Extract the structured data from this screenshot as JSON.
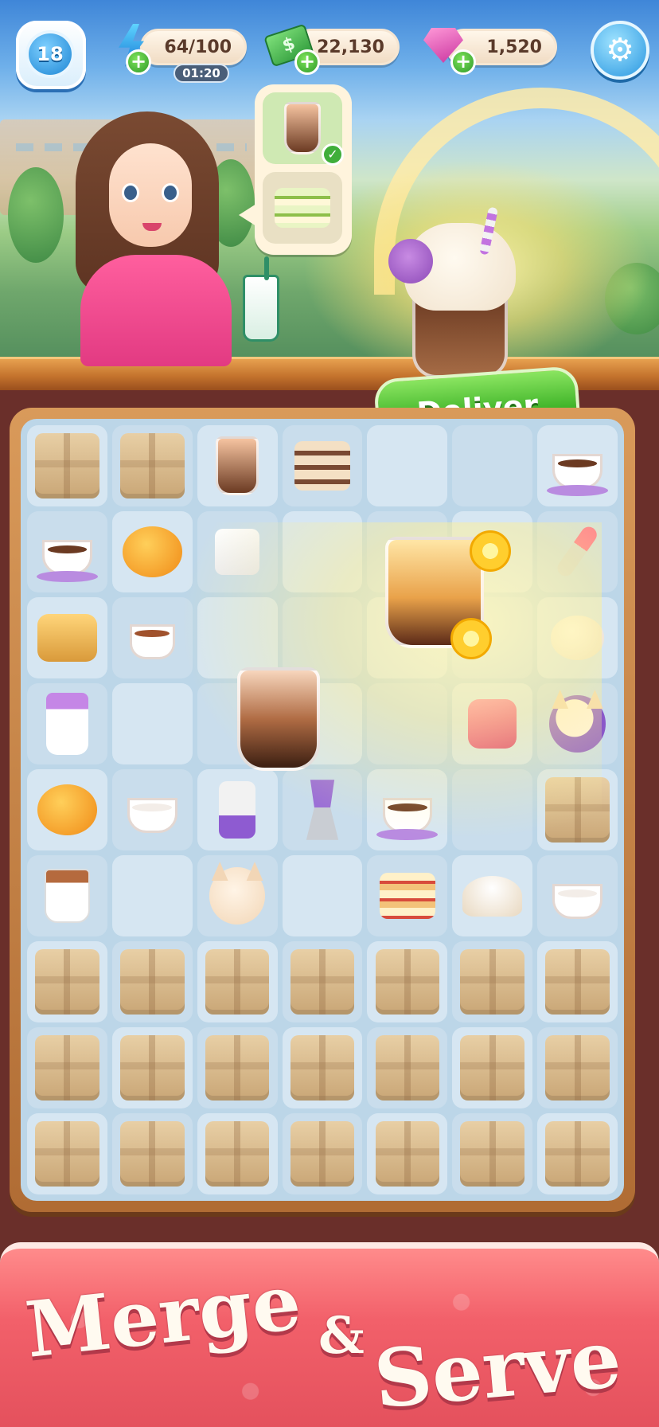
{
  "hud": {
    "level": "18",
    "energy": {
      "value": "64/100",
      "timer": "01:20"
    },
    "cash": {
      "value": "22,130",
      "icon_text": "$"
    },
    "gems": {
      "value": "1,520"
    },
    "plus_symbol": "+",
    "settings_icon": "⚙"
  },
  "order": {
    "items": [
      {
        "name": "whipped-mocha-drink",
        "completed": true,
        "check_symbol": "✓"
      },
      {
        "name": "matcha-layer-cake",
        "completed": false
      }
    ]
  },
  "deliver": {
    "label": "Deliver",
    "item": "whipped-mocha-drink"
  },
  "board": {
    "columns": 7,
    "rows": 9,
    "cells": [
      [
        "box",
        "box",
        "iced-tea",
        "cake-slice",
        "empty",
        "empty",
        "coffee-cup"
      ],
      [
        "latte-cup",
        "melon-bun",
        "sugar-cube",
        "empty",
        "empty",
        "empty",
        "whisk"
      ],
      [
        "toast",
        "spiced-tea",
        "empty",
        "empty",
        "empty",
        "empty",
        "dough"
      ],
      [
        "paper-cup",
        "empty",
        "empty",
        "empty",
        "empty",
        "hand-mixer",
        "cat-purple"
      ],
      [
        "bun",
        "empty-cup",
        "blender",
        "moka-pot",
        "tea-cup",
        "empty",
        "box"
      ],
      [
        "teabag-cup",
        "empty",
        "kitten",
        "empty",
        "layer-cake",
        "flour",
        "empty-cup"
      ],
      [
        "box",
        "box",
        "box",
        "box",
        "box",
        "box",
        "box"
      ],
      [
        "box",
        "box",
        "box",
        "box",
        "box",
        "box",
        "box"
      ],
      [
        "box",
        "box",
        "box",
        "box",
        "box",
        "box",
        "box"
      ]
    ]
  },
  "footer": {
    "word1": "Merge",
    "ampersand": "&",
    "word2": "Serve"
  },
  "colors": {
    "accent_green": "#41b52a",
    "banner_red": "#f2606a",
    "board_bg": "#bcd6e8"
  }
}
